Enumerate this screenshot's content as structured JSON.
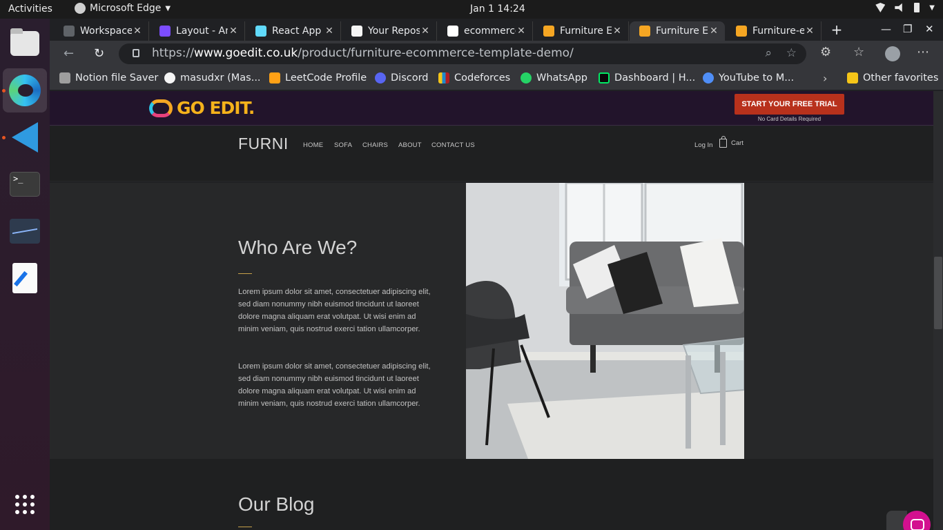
{
  "topbar": {
    "activities": "Activities",
    "app_name": "Microsoft Edge",
    "clock": "Jan 1  14:24"
  },
  "browser": {
    "tabs": [
      {
        "title": "Workspace",
        "icon_color": "#5f6368"
      },
      {
        "title": "Layout - An",
        "icon_color": "#7c4dff"
      },
      {
        "title": "React App",
        "icon_color": "#61dafb"
      },
      {
        "title": "Your Repos",
        "icon_color": "#f5f5f5"
      },
      {
        "title": "ecommerce",
        "icon_color": "#ffffff"
      },
      {
        "title": "Furniture E",
        "icon_color": "#f5a623"
      },
      {
        "title": "Furniture E",
        "icon_color": "#f5a623"
      },
      {
        "title": "Furniture-e",
        "icon_color": "#f5a623"
      }
    ],
    "url_prefix": "https://",
    "url_domain": "www.goedit.co.uk",
    "url_path": "/product/furniture-ecommerce-template-demo/",
    "bookmarks": [
      {
        "label": "Notion file Saver",
        "color": "#9e9e9e"
      },
      {
        "label": "masudxr (Mas...",
        "color": "#f5f5f5"
      },
      {
        "label": "LeetCode Profile",
        "color": "#ffa116"
      },
      {
        "label": "Discord",
        "color": "#5865f2"
      },
      {
        "label": "Codeforces",
        "color": "#1f8acb"
      },
      {
        "label": "WhatsApp",
        "color": "#25d366"
      },
      {
        "label": "Dashboard | H...",
        "color": "#00ea64"
      },
      {
        "label": "YouTube to M...",
        "color": "#4f8ef7"
      }
    ],
    "other_favorites": "Other favorites"
  },
  "goedit": {
    "logo": "GO EDIT.",
    "trial_button": "START YOUR FREE TRIAL",
    "trial_note": "No Card Details Required"
  },
  "site": {
    "brand": "FURNI",
    "nav": [
      "HOME",
      "SOFA",
      "CHAIRS",
      "ABOUT",
      "CONTACT US"
    ],
    "login": "Log In",
    "cart": "Cart"
  },
  "about": {
    "heading": "Who Are We?",
    "paragraph_1": "Lorem ipsum dolor sit amet, consectetuer adipiscing elit, sed diam nonummy nibh euismod tincidunt ut laoreet dolore magna aliquam erat volutpat. Ut wisi enim ad minim veniam, quis nostrud exerci tation ullamcorper.",
    "paragraph_2": "Lorem ipsum dolor sit amet, consectetuer adipiscing elit, sed diam nonummy nibh euismod tincidunt ut laoreet dolore magna aliquam erat volutpat. Ut wisi enim ad minim veniam, quis nostrud exerci tation ullamcorper."
  },
  "blog": {
    "heading": "Our Blog"
  }
}
